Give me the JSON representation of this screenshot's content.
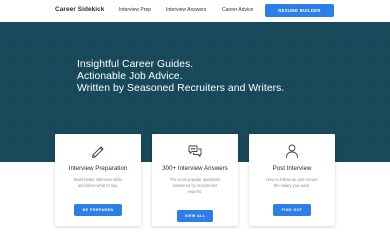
{
  "nav": {
    "logo": "Career Sidekick",
    "links": [
      "Interview Prep",
      "Interview Answers",
      "Career Advice"
    ],
    "cta": "RESUME BUILDER",
    "accent": "#2c7fe6"
  },
  "hero": {
    "lines": [
      "Insightful Career Guides.",
      "Actionable Job Advice.",
      "Written by Seasoned Recruiters and Writers."
    ],
    "background": "#17495a"
  },
  "cards": [
    {
      "icon": "pencil-icon",
      "title": "Interview Preparation",
      "desc_lines": [
        "Build better interview skills",
        "and know what to say."
      ],
      "button": "BE PREPARED"
    },
    {
      "icon": "chat-bubbles-icon",
      "title": "300+ Interview Answers",
      "desc_lines": [
        "The most popular questions",
        "answered by recruitment",
        "experts."
      ],
      "button": "VIEW ALL"
    },
    {
      "icon": "person-icon",
      "title": "Post Interview",
      "desc_lines": [
        "How to follow-up and secure",
        "the salary you want."
      ],
      "button": "FIND OUT"
    }
  ]
}
